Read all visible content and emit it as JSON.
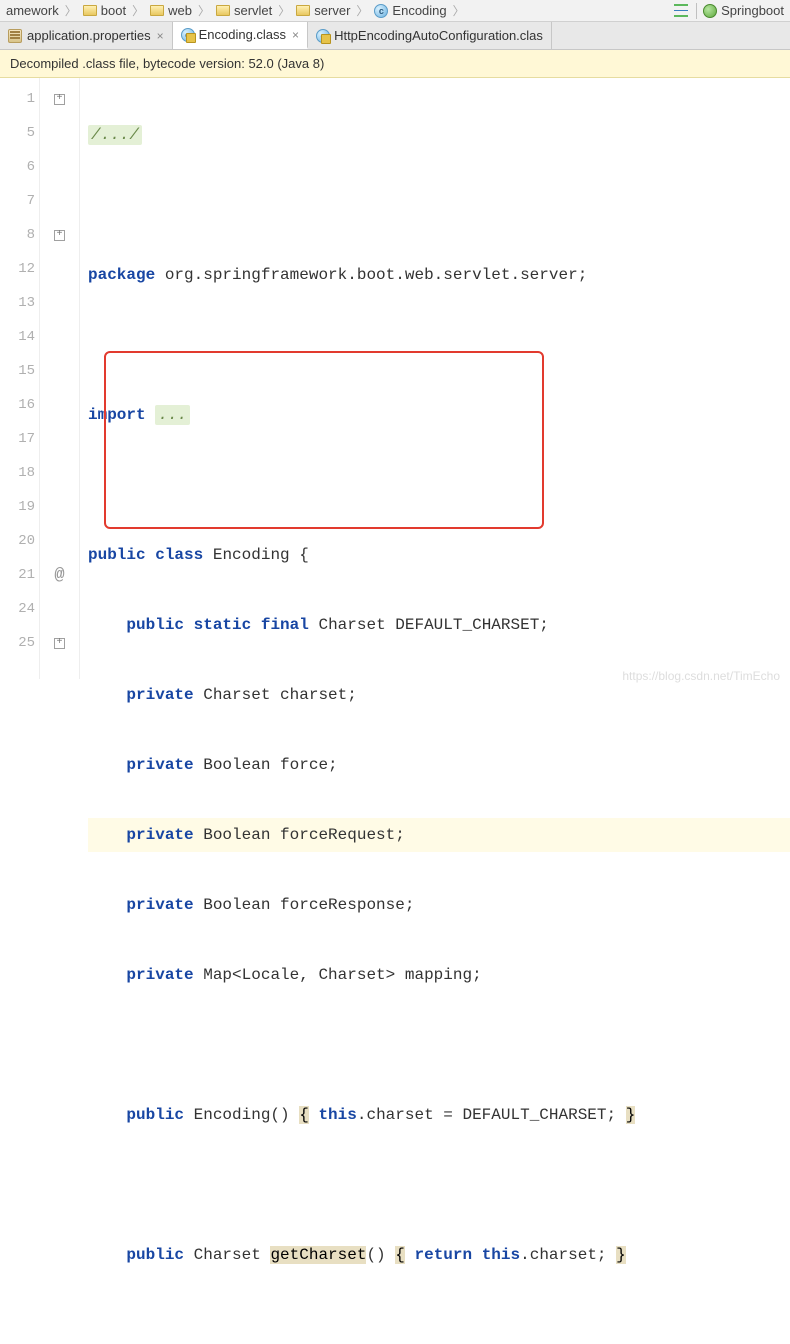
{
  "breadcrumb": {
    "items": [
      {
        "label": "amework",
        "icon": "folder"
      },
      {
        "label": "boot",
        "icon": "folder"
      },
      {
        "label": "web",
        "icon": "folder"
      },
      {
        "label": "servlet",
        "icon": "folder"
      },
      {
        "label": "server",
        "icon": "folder"
      },
      {
        "label": "Encoding",
        "icon": "class"
      }
    ],
    "run_config": "Springboot"
  },
  "tabs": {
    "items": [
      {
        "label": "application.properties",
        "icon": "prop",
        "active": false
      },
      {
        "label": "Encoding.class",
        "icon": "class",
        "active": true,
        "locked": true
      },
      {
        "label": "HttpEncodingAutoConfiguration.clas",
        "icon": "class",
        "active": false,
        "locked": true
      }
    ]
  },
  "banner": {
    "text": "Decompiled .class file, bytecode version: 52.0 (Java 8)"
  },
  "gutter": {
    "lines": [
      "1",
      "5",
      "6",
      "7",
      "8",
      "12",
      "13",
      "14",
      "15",
      "16",
      "17",
      "18",
      "19",
      "20",
      "21",
      "24",
      "25"
    ]
  },
  "code": {
    "l1_fold": "/.../",
    "l6_kw": "package",
    "l6_rest": " org.springframework.boot.web.servlet.server;",
    "l8_kw": "import",
    "l8_fold": "...",
    "l13_kw1": "public",
    "l13_kw2": "class",
    "l13_rest": " Encoding {",
    "l14_kw1": "public",
    "l14_kw2": "static",
    "l14_kw3": "final",
    "l14_rest": " Charset DEFAULT_CHARSET;",
    "l15_kw": "private",
    "l15_rest": " Charset charset;",
    "l16_kw": "private",
    "l16_rest": " Boolean force;",
    "l17_kw": "private",
    "l17_rest": " Boolean forceRequest;",
    "l18_kw": "private",
    "l18_rest": " Boolean forceResponse;",
    "l19_kw": "private",
    "l19_rest": " Map<Locale, Charset> mapping;",
    "l21_kw1": "public",
    "l21_name": " Encoding() ",
    "l21_br1": "{",
    "l21_kw2": "this",
    "l21_rest": ".charset = DEFAULT_CHARSET; ",
    "l21_br2": "}",
    "l25_kw1": "public",
    "l25_type": " Charset ",
    "l25_name": "getCharset",
    "l25_paren": "() ",
    "l25_br1": "{",
    "l25_kw2": "return",
    "l25_kw3": "this",
    "l25_rest": ".charset; ",
    "l25_br2": "}"
  },
  "watermark": "https://blog.csdn.net/TimEcho"
}
